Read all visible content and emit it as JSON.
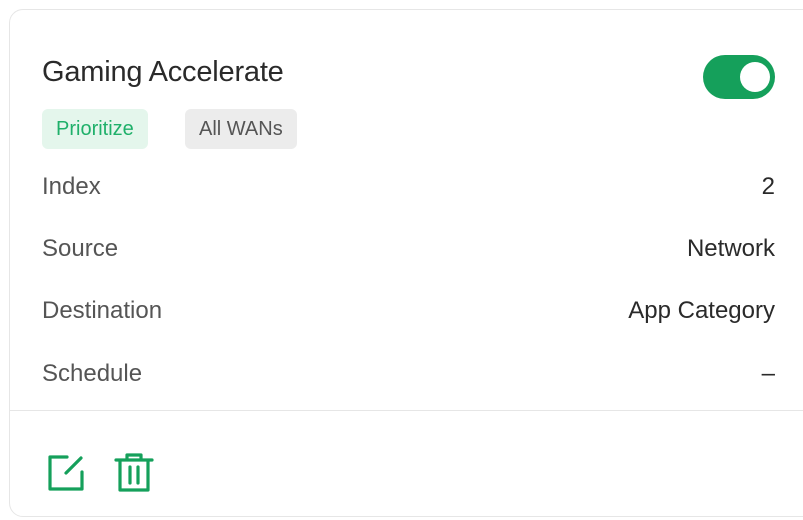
{
  "card": {
    "title": "Gaming Accelerate",
    "enabled": true,
    "tags": {
      "prioritize": "Prioritize",
      "wans": "All WANs"
    },
    "details": [
      {
        "label": "Index",
        "value": "2"
      },
      {
        "label": "Source",
        "value": "Network"
      },
      {
        "label": "Destination",
        "value": "App Category"
      },
      {
        "label": "Schedule",
        "value": "–"
      }
    ],
    "actions": {
      "edit_icon": "edit-icon",
      "delete_icon": "trash-icon"
    }
  },
  "colors": {
    "accent": "#15a05b",
    "tag_green_bg": "#e4f6ec",
    "tag_green_text": "#1fb06a",
    "tag_gray_bg": "#ececec"
  }
}
